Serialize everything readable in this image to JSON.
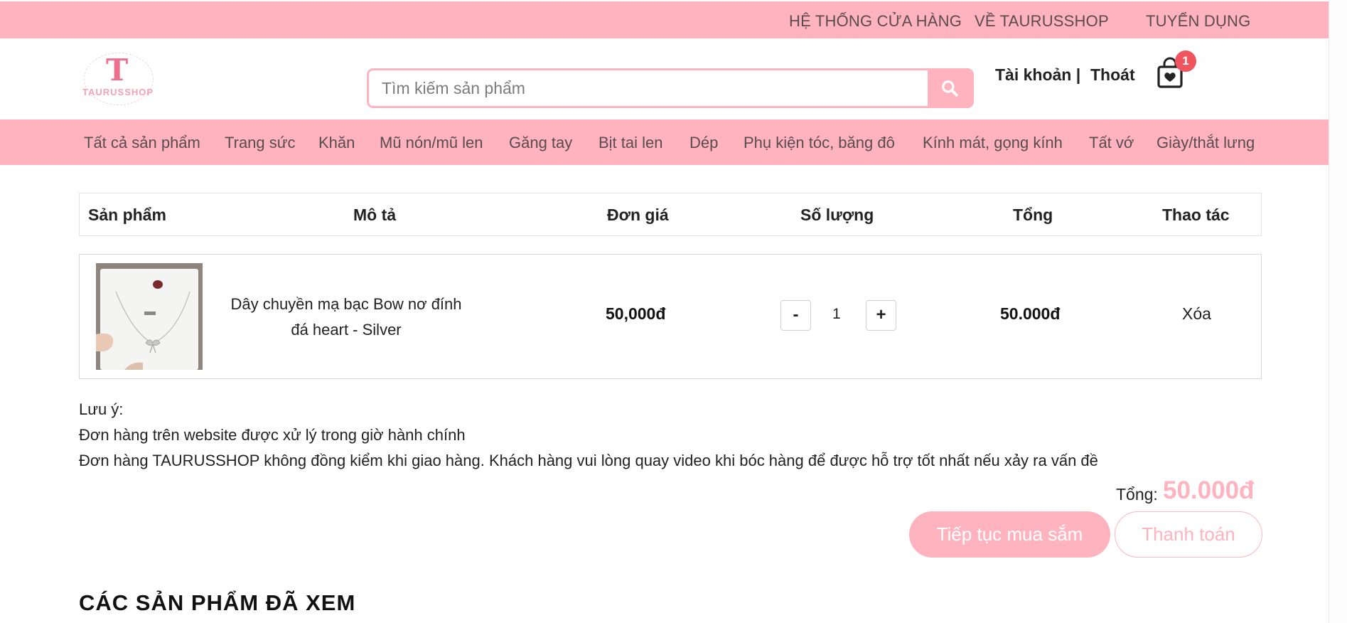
{
  "topbar": {
    "links": [
      "HỆ THỐNG CỬA HÀNG",
      "VỀ TAURUSSHOP",
      "TUYỂN DỤNG"
    ]
  },
  "header": {
    "logo_letter": "T",
    "logo_text": "TAURUSSHOP",
    "search_placeholder": "Tìm kiếm sản phẩm",
    "account_label": "Tài khoản |",
    "logout_label": "Thoát",
    "cart_count": "1"
  },
  "nav": {
    "items": [
      "Tất cả sản phẩm",
      "Trang sức",
      "Khăn",
      "Mũ nón/mũ len",
      "Găng tay",
      "Bịt tai len",
      "Dép",
      "Phụ kiện tóc, băng đô",
      "Kính mát, gọng kính",
      "Tất vớ",
      "Giày/thắt lưng"
    ]
  },
  "cart_table": {
    "headers": [
      "Sản phẩm",
      "Mô tả",
      "Đơn giá",
      "Số lượng",
      "Tổng",
      "Thao tác"
    ],
    "items": [
      {
        "description": "Dây chuyền mạ bạc Bow nơ đính đá heart - Silver",
        "unit_price": "50,000đ",
        "quantity": "1",
        "total": "50.000đ",
        "action": "Xóa"
      }
    ],
    "minus_label": "-",
    "plus_label": "+"
  },
  "notes": {
    "title": "Lưu ý:",
    "line1": "Đơn hàng trên website được xử lý trong giờ hành chính",
    "line2": "Đơn hàng TAURUSSHOP không đồng kiểm khi giao hàng. Khách hàng vui lòng quay video khi bóc hàng để được hỗ trợ tốt nhất nếu xảy ra vấn đề"
  },
  "summary": {
    "total_label": "Tổng:",
    "total_value": "50.000đ",
    "continue_label": "Tiếp tục mua sắm",
    "checkout_label": "Thanh toán"
  },
  "viewed_heading": "CÁC SẢN PHẨM ĐÃ XEM",
  "colors": {
    "accent_pink": "#ffb3bf",
    "badge_red": "#f0545d"
  }
}
